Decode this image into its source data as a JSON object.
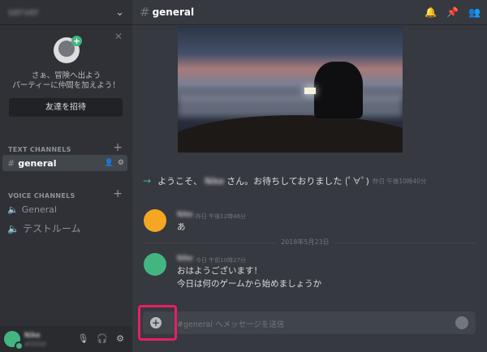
{
  "server": {
    "name": "server"
  },
  "invite": {
    "line1": "さぁ、冒険へ出よう",
    "line2": "パーティーに仲間を加えよう！",
    "button": "友達を招待"
  },
  "categories": {
    "text": "TEXT CHANNELS",
    "voice": "VOICE CHANNELS"
  },
  "channels": {
    "text": [
      {
        "name": "general"
      }
    ],
    "voice": [
      {
        "name": "General"
      },
      {
        "name": "テストルーム"
      }
    ]
  },
  "user": {
    "name": "Nike",
    "tag": "#0000"
  },
  "header": {
    "channel": "general"
  },
  "welcome": {
    "pre": "ようこそ、",
    "user": "Nike",
    "post": "さん。お待ちしておりました (ﾟ∀ﾟ)",
    "time": "昨日 午後10時40分"
  },
  "messages": [
    {
      "author": "Nike",
      "time": "昨日 午後12時46分",
      "lines": [
        "あ"
      ],
      "avatar_color": "#f5a623"
    },
    {
      "author": "Nike",
      "time": "今日 午前10時27分",
      "lines": [
        "おはようございます！",
        "今日は何のゲームから始めましょうか"
      ],
      "avatar_color": "#43b581"
    }
  ],
  "date_divider": "2018年5月23日",
  "composer": {
    "placeholder": "#general へメッセージを送信"
  },
  "icons": [
    "chevron-down-icon",
    "close-icon",
    "hash-icon",
    "speaker-icon",
    "plus-icon",
    "user-add-icon",
    "gear-icon",
    "mic-icon",
    "headphones-icon",
    "bell-icon",
    "pin-icon",
    "members-icon",
    "emoji-icon",
    "attach-icon",
    "arrow-icon"
  ]
}
